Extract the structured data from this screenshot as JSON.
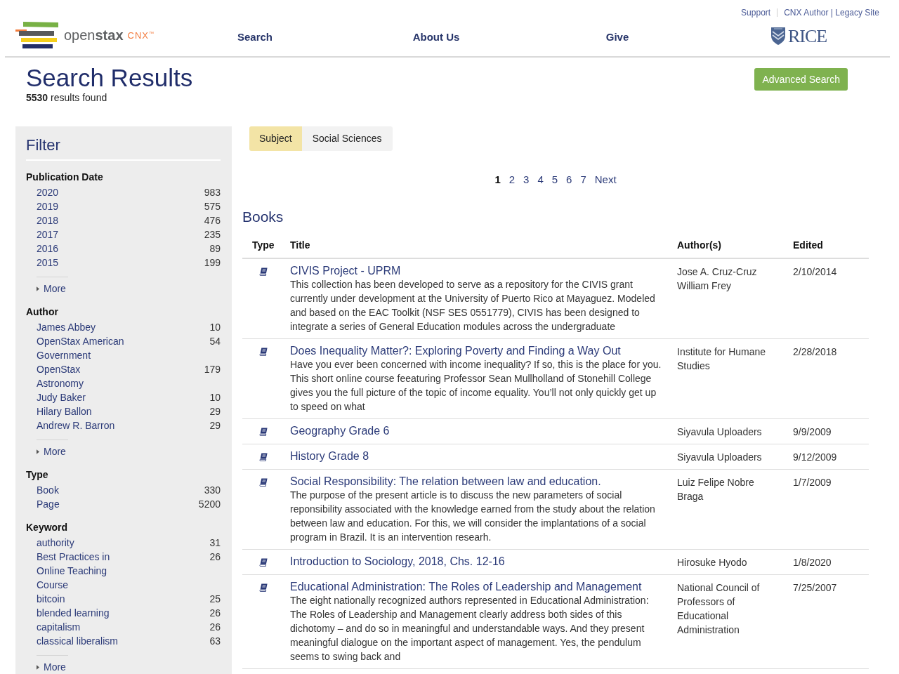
{
  "header": {
    "utility_links": [
      "Support",
      "CNX Author | Legacy Site"
    ],
    "logo": {
      "wordmark": "open**stax**",
      "product": "CNX$^{™}$"
    },
    "nav": [
      "Search",
      "About Us",
      "Give"
    ],
    "partner_logo": "RICE"
  },
  "page_title": "Search Results",
  "result_count": "**5530** results found",
  "advanced_search_button": "Advanced Search",
  "filter": {
    "title": "Filter",
    "sections": [
      {
        "title": "Publication Date",
        "items": [
          {
            "label": "2020",
            "count": "983"
          },
          {
            "label": "2019",
            "count": "575"
          },
          {
            "label": "2018",
            "count": "476"
          },
          {
            "label": "2017",
            "count": "235"
          },
          {
            "label": "2016",
            "count": "89"
          },
          {
            "label": "2015",
            "count": "199"
          }
        ],
        "more": "More"
      },
      {
        "title": "Author",
        "items": [
          {
            "label": "James Abbey",
            "count": "10"
          },
          {
            "label": "OpenStax American Government",
            "count": "54"
          },
          {
            "label": "OpenStax Astronomy",
            "count": "179"
          },
          {
            "label": "Judy Baker",
            "count": "10"
          },
          {
            "label": "Hilary Ballon",
            "count": "29"
          },
          {
            "label": "Andrew R. Barron",
            "count": "29"
          }
        ],
        "more": "More"
      },
      {
        "title": "Type",
        "items": [
          {
            "label": "Book",
            "count": "330"
          },
          {
            "label": "Page",
            "count": "5200"
          }
        ]
      },
      {
        "title": "Keyword",
        "items": [
          {
            "label": "authority",
            "count": "31"
          },
          {
            "label": "Best Practices in Online Teaching Course",
            "count": "26"
          },
          {
            "label": "bitcoin",
            "count": "25"
          },
          {
            "label": "blended learning",
            "count": "26"
          },
          {
            "label": "capitalism",
            "count": "26"
          },
          {
            "label": "classical liberalism",
            "count": "63"
          }
        ],
        "more": "More"
      }
    ]
  },
  "active_filter": {
    "label": "Subject",
    "value": "Social Sciences"
  },
  "pagination": {
    "pages": [
      {
        "label": "1",
        "selected": true
      },
      {
        "label": "2",
        "selected": false
      },
      {
        "label": "3",
        "selected": false
      },
      {
        "label": "4",
        "selected": false
      },
      {
        "label": "5",
        "selected": false
      },
      {
        "label": "6",
        "selected": false
      },
      {
        "label": "7",
        "selected": false
      }
    ],
    "next": "Next"
  },
  "results": {
    "heading": "Books",
    "columns": [
      "Type",
      "Title",
      "Author(s)",
      "Edited"
    ],
    "rows": [
      {
        "kind": "book",
        "title": "CIVIS Project - UPRM",
        "description": "This collection has been developed to serve as a repository for the CIVIS grant currently under development at the University of Puerto Rico at Mayaguez. Modeled and based on the EAC Toolkit (NSF SES 0551779), CIVIS has been designed to integrate a series of General Education modules across the undergraduate",
        "authors": [
          "Jose A. Cruz-Cruz",
          "William Frey"
        ],
        "edited": "2/10/2014"
      },
      {
        "kind": "book",
        "title": "Does Inequality Matter?: Exploring Poverty and Finding a Way Out",
        "description": "Have you ever been concerned with income inequality? If so, this is the place for you. This short online course feeaturing Professor Sean Mullholland of Stonehill College gives you the full picture of the topic of income equality. You’ll not only quickly get up to speed on what",
        "authors": [
          "Institute for Humane Studies"
        ],
        "edited": "2/28/2018"
      },
      {
        "kind": "book",
        "title": "Geography Grade 6",
        "authors": [
          "Siyavula Uploaders"
        ],
        "edited": "9/9/2009"
      },
      {
        "kind": "book",
        "title": "History Grade 8",
        "authors": [
          "Siyavula Uploaders"
        ],
        "edited": "9/12/2009"
      },
      {
        "kind": "book",
        "title": "Social Responsibility: The relation between law and education.",
        "description": "The purpose of the present article is to discuss the new parameters of social reponsibility associated with the knowledge earned from the study about the relation between law and education. For this, we will consider the implantations of a social program in Brazil. It is an intervention researh.",
        "authors": [
          "Luiz Felipe Nobre Braga"
        ],
        "edited": "1/7/2009"
      },
      {
        "kind": "book",
        "title": "Introduction to Sociology, 2018, Chs. 12-16",
        "authors": [
          "Hirosuke Hyodo"
        ],
        "edited": "1/8/2020"
      },
      {
        "kind": "book",
        "title": "Educational Administration: The Roles of Leadership and Management",
        "description": "The eight nationally recognized authors represented in Educational Administration: The Roles of Leadership and Management clearly address both sides of this dichotomy – and do so in meaningful and understandable ways. And they present meaningful dialogue on the important aspect of management. Yes, the pendulum seems to swing back and",
        "authors": [
          "National Council of Professors of Educational Administration"
        ],
        "edited": "7/25/2007"
      }
    ]
  }
}
